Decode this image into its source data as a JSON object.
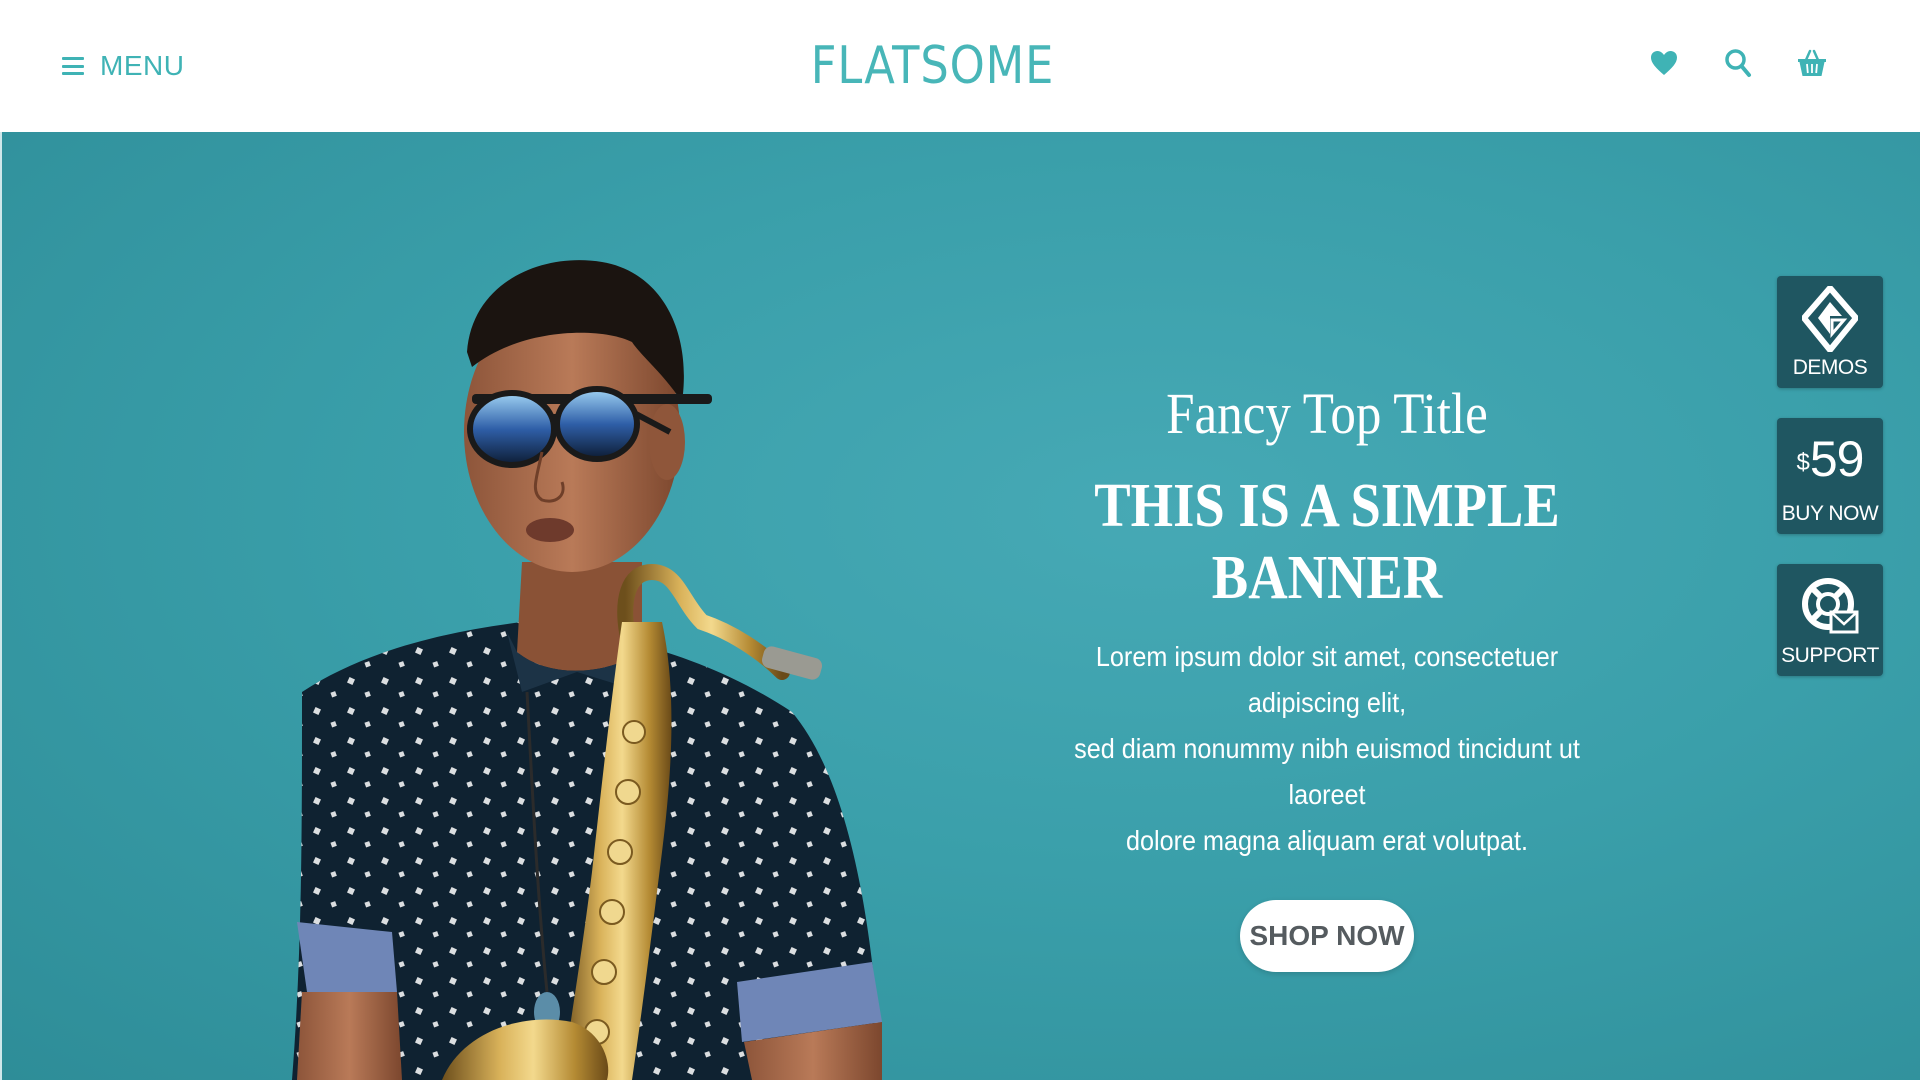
{
  "header": {
    "menu_label": "MENU",
    "logo_text": "FLATSOME",
    "icons": [
      "heart-icon",
      "search-icon",
      "cart-icon"
    ]
  },
  "hero": {
    "fancy_title": "Fancy Top Title",
    "title_line1": "THIS IS A SIMPLE",
    "title_line2": "BANNER",
    "text_line1": "Lorem ipsum dolor sit amet, consectetuer adipiscing elit,",
    "text_line2": "sed diam nonummy nibh euismod tincidunt ut laoreet",
    "text_line3": "dolore magna aliquam erat volutpat.",
    "button_label": "SHOP NOW"
  },
  "side_widgets": {
    "demos_label": "DEMOS",
    "price_currency": "$",
    "price_amount": "59",
    "buy_label": "BUY NOW",
    "support_label": "SUPPORT"
  },
  "colors": {
    "accent": "#3fb3b5",
    "hero_background": "#3a9faa",
    "widget_background": "#1f5661",
    "button_text": "#555b5f"
  }
}
